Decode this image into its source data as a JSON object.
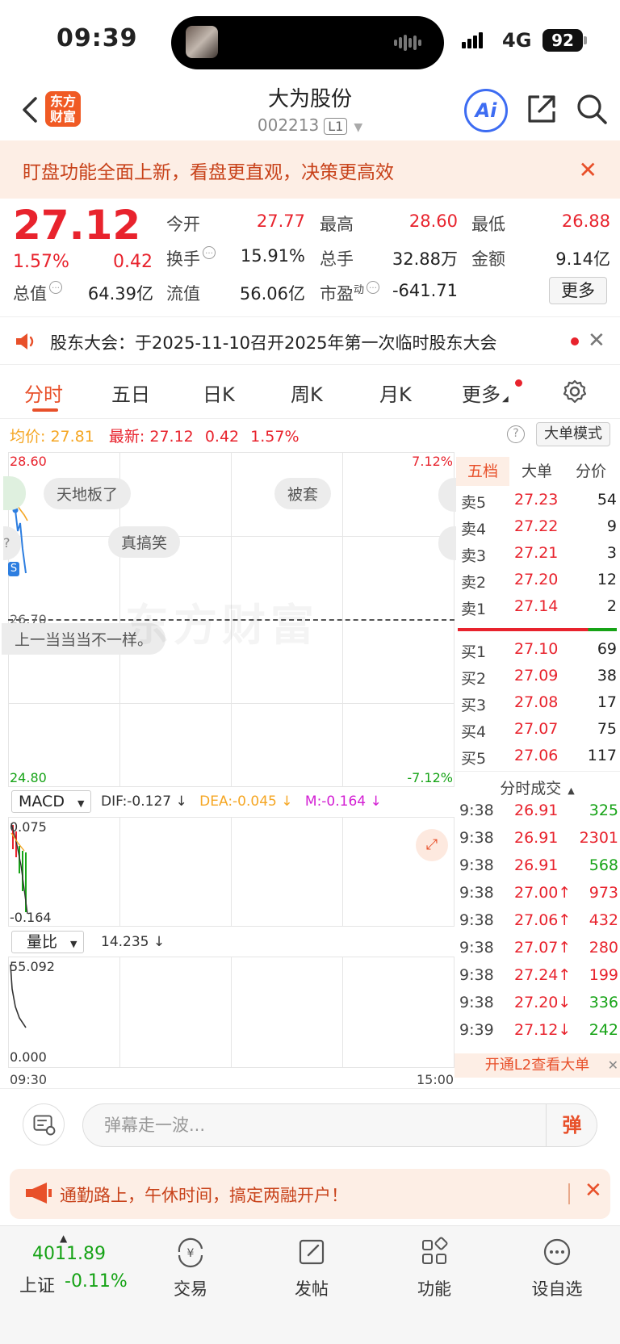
{
  "status_bar": {
    "time": "09:39",
    "network": "4G",
    "battery": "92"
  },
  "header": {
    "logo_text": "东方财富",
    "stock_name": "大为股份",
    "stock_code": "002213",
    "level_badge": "L1",
    "ai_label": "Ai"
  },
  "banner": {
    "text": "盯盘功能全面上新，看盘更直观，决策更高效"
  },
  "quote": {
    "price": "27.12",
    "change_pct": "1.57%",
    "change_val": "0.42",
    "rows": [
      [
        {
          "label": "今开",
          "value": "27.77",
          "color": "red"
        },
        {
          "label": "最高",
          "value": "28.60",
          "color": "red"
        },
        {
          "label": "最低",
          "value": "26.88",
          "color": "red"
        }
      ],
      [
        {
          "label": "换手",
          "value": "15.91%",
          "color": "dark"
        },
        {
          "label": "总手",
          "value": "32.88万",
          "color": "dark"
        },
        {
          "label": "金额",
          "value": "9.14亿",
          "color": "dark"
        }
      ]
    ],
    "row3": {
      "total_mv_label": "总值",
      "total_mv": "64.39亿",
      "float_mv_label": "流值",
      "float_mv": "56.06亿",
      "pe_label": "市盈",
      "pe_sup": "动",
      "pe": "-641.71"
    },
    "more_label": "更多"
  },
  "notice": {
    "text": "股东大会：于2025-11-10召开2025年第一次临时股东大会"
  },
  "tabs": [
    "分时",
    "五日",
    "日K",
    "周K",
    "月K",
    "更多"
  ],
  "avg_row": {
    "avg_label": "均价:",
    "avg_value": "27.81",
    "latest_label": "最新:",
    "latest_value": "27.12",
    "chg_val": "0.42",
    "chg_pct": "1.57%",
    "help": "?",
    "big_order_mode": "大单模式"
  },
  "chart": {
    "y_high": "28.60",
    "y_low": "24.80",
    "y_mid": "26.70",
    "pct_high": "7.12%",
    "pct_low": "-7.12%",
    "time_start": "09:30",
    "time_end": "15:00",
    "watermark": "东方财富",
    "bubbles": [
      "天地板了",
      "被套",
      "真搞笑",
      "上一当当当不一样。"
    ],
    "macd": {
      "name": "MACD",
      "dif": "DIF:-0.127 ↓",
      "dea": "DEA:-0.045 ↓",
      "m": "M:-0.164 ↓",
      "top": "0.075",
      "bottom": "-0.164"
    },
    "vol_ratio": {
      "name": "量比",
      "value": "14.235 ↓",
      "top": "55.092",
      "bottom": "0.000"
    }
  },
  "orderbook": {
    "tabs": [
      "五档",
      "大单",
      "分价"
    ],
    "asks": [
      {
        "label": "卖5",
        "price": "27.23",
        "vol": "54"
      },
      {
        "label": "卖4",
        "price": "27.22",
        "vol": "9"
      },
      {
        "label": "卖3",
        "price": "27.21",
        "vol": "3"
      },
      {
        "label": "卖2",
        "price": "27.20",
        "vol": "12"
      },
      {
        "label": "卖1",
        "price": "27.14",
        "vol": "2"
      }
    ],
    "bids": [
      {
        "label": "买1",
        "price": "27.10",
        "vol": "69"
      },
      {
        "label": "买2",
        "price": "27.09",
        "vol": "38"
      },
      {
        "label": "买3",
        "price": "27.08",
        "vol": "17"
      },
      {
        "label": "买4",
        "price": "27.07",
        "vol": "75"
      },
      {
        "label": "买5",
        "price": "27.06",
        "vol": "117"
      }
    ],
    "ticks_title": "分时成交",
    "ticks": [
      {
        "time": "9:38",
        "price": "26.91",
        "vol": "325",
        "dir": "green"
      },
      {
        "time": "9:38",
        "price": "26.91",
        "vol": "2301",
        "dir": "red"
      },
      {
        "time": "9:38",
        "price": "26.91",
        "vol": "568",
        "dir": "green"
      },
      {
        "time": "9:38",
        "price": "27.00↑",
        "vol": "973",
        "dir": "red"
      },
      {
        "time": "9:38",
        "price": "27.06↑",
        "vol": "432",
        "dir": "red"
      },
      {
        "time": "9:38",
        "price": "27.07↑",
        "vol": "280",
        "dir": "red"
      },
      {
        "time": "9:38",
        "price": "27.24↑",
        "vol": "199",
        "dir": "red"
      },
      {
        "time": "9:38",
        "price": "27.20↓",
        "vol": "336",
        "dir": "green"
      },
      {
        "time": "9:39",
        "price": "27.12↓",
        "vol": "242",
        "dir": "green"
      }
    ],
    "l2_text": "开通L2查看大单"
  },
  "comment": {
    "placeholder": "弹幕走一波...",
    "danmu_btn": "弹"
  },
  "promo": {
    "text": "通勤路上，午休时间，搞定两融开户！"
  },
  "bottom_nav": {
    "index_value": "4011.89",
    "index_name": "上证",
    "index_chg": "-0.11%",
    "items": [
      "交易",
      "发帖",
      "功能",
      "设自选"
    ]
  }
}
